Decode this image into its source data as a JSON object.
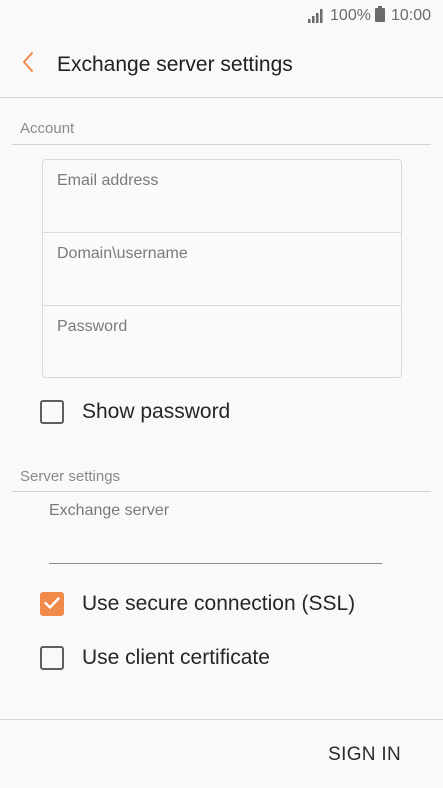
{
  "status_bar": {
    "battery_percent": "100%",
    "time": "10:00",
    "icons": [
      "signal-icon",
      "battery-icon"
    ]
  },
  "header": {
    "title": "Exchange server settings",
    "back_icon": "chevron-left-icon"
  },
  "account": {
    "section_label": "Account",
    "email_placeholder": "Email address",
    "domain_placeholder": "Domain\\username",
    "password_placeholder": "Password",
    "show_password_label": "Show password",
    "show_password_checked": false
  },
  "server": {
    "section_label": "Server settings",
    "exchange_server_placeholder": "Exchange server",
    "ssl_label": "Use secure connection (SSL)",
    "ssl_checked": true,
    "client_cert_label": "Use client certificate",
    "client_cert_checked": false
  },
  "footer": {
    "sign_in_label": "SIGN IN"
  },
  "colors": {
    "accent": "#f08a4b",
    "background": "#f9f9f9",
    "divider": "#d6d6d6"
  }
}
